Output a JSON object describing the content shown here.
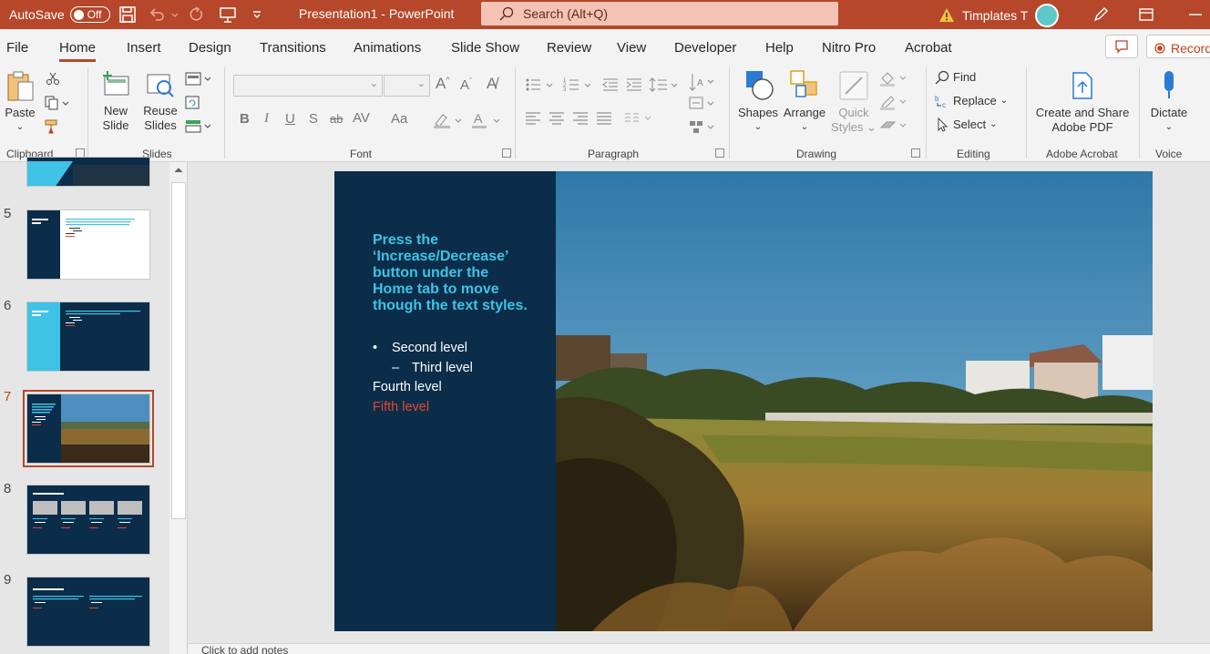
{
  "titlebar": {
    "autosave_label": "AutoSave",
    "autosave_state": "Off",
    "document_title": "Presentation1  -  PowerPoint",
    "search_placeholder": "Search (Alt+Q)",
    "user_name": "Timplates T",
    "colors": {
      "titlebar_bg": "#b7472a",
      "search_bg": "#f4c3b3"
    }
  },
  "menu": {
    "tabs": [
      "File",
      "Home",
      "Insert",
      "Design",
      "Transitions",
      "Animations",
      "Slide Show",
      "Review",
      "View",
      "Developer",
      "Help",
      "Nitro Pro",
      "Acrobat"
    ],
    "active_tab": "Home",
    "record_label": "Record"
  },
  "ribbon": {
    "clipboard": {
      "paste": "Paste",
      "group": "Clipboard"
    },
    "slides": {
      "new_slide_1": "New",
      "new_slide_2": "Slide",
      "reuse_1": "Reuse",
      "reuse_2": "Slides",
      "group": "Slides"
    },
    "font": {
      "group": "Font",
      "bold": "B",
      "italic": "I",
      "underline": "U",
      "shadow": "S",
      "strike": "ab",
      "spacing": "AV",
      "case": "Aa"
    },
    "paragraph": {
      "group": "Paragraph"
    },
    "drawing": {
      "shapes": "Shapes",
      "arrange": "Arrange",
      "quick_1": "Quick",
      "quick_2": "Styles",
      "group": "Drawing"
    },
    "editing": {
      "find": "Find",
      "replace": "Replace",
      "select": "Select",
      "group": "Editing"
    },
    "acrobat": {
      "create_1": "Create and Share",
      "create_2": "Adobe PDF",
      "group": "Adobe Acrobat"
    },
    "voice": {
      "dictate": "Dictate",
      "group": "Voice"
    }
  },
  "thumbnails": [
    {
      "number": "5",
      "type": "title-text"
    },
    {
      "number": "6",
      "type": "cyan-block"
    },
    {
      "number": "7",
      "type": "photo",
      "selected": true
    },
    {
      "number": "8",
      "type": "four-boxes"
    },
    {
      "number": "9",
      "type": "two-columns"
    }
  ],
  "slide": {
    "title": "Press the ‘Increase/Decrease’ button under the Home tab to move though the text styles.",
    "level2": "Second level",
    "level3": "Third level",
    "level4": "Fourth level",
    "level5": "Fifth level",
    "bullet2": "•",
    "bullet3": "–",
    "colors": {
      "background": "#0b2d4a",
      "title": "#3ec3e6",
      "fifth_level": "#e5462a"
    }
  },
  "notes": {
    "placeholder": "Click to add notes"
  }
}
